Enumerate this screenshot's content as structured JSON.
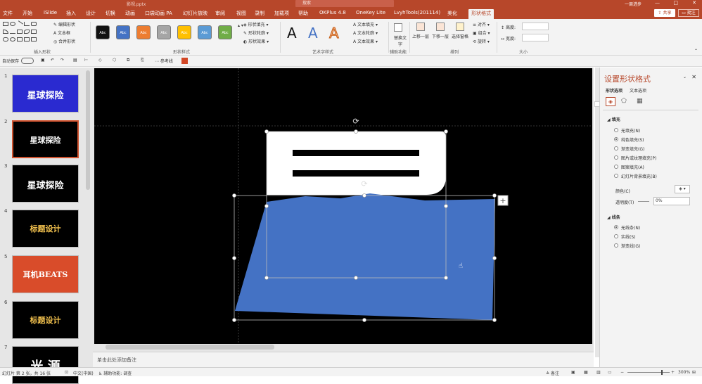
{
  "title_bar": {
    "file": "影视.pptx",
    "search": "搜索",
    "user": "一周进步"
  },
  "tabs": [
    "文件",
    "开始",
    "iSlide",
    "插入",
    "设计",
    "切换",
    "动画",
    "口袋动画 PA",
    "幻灯片放映",
    "审阅",
    "视图",
    "录制",
    "加载项",
    "帮助",
    "OKPlus 4.8",
    "OneKey Lite",
    "LvyhTools(201114)",
    "美化",
    "形状格式"
  ],
  "active_tab": "形状格式",
  "share": "共享",
  "comment": "批注",
  "ribbon": {
    "insert_shapes": {
      "label": "插入形状",
      "edit_shape": "编辑形状",
      "text_box": "文本框",
      "merge_shapes": "合并形状"
    },
    "shape_styles": {
      "label": "形状样式",
      "swatch_text": "Abc",
      "fill": "形状填充",
      "outline": "形状轮廓",
      "effects": "形状效果",
      "swatch_colors": [
        "#111111",
        "#4472c4",
        "#ed7d31",
        "#a5a5a5",
        "#ffc000",
        "#5b9bd5",
        "#70ad47"
      ]
    },
    "wordart": {
      "label": "艺术字样式",
      "letters": [
        "A",
        "A",
        "A"
      ],
      "text_fill": "文本填充",
      "text_outline": "文本轮廓",
      "text_effects": "文本效果"
    },
    "accessibility": {
      "label": "辅助功能",
      "alt_text": "替换文字"
    },
    "arrange": {
      "label": "排列",
      "bring_forward": "上移一层",
      "send_backward": "下移一层",
      "selection_pane": "选择窗格",
      "align": "对齐",
      "group": "组合",
      "rotate": "旋转"
    },
    "size": {
      "label": "大小",
      "height": "高度:",
      "width": "宽度:"
    }
  },
  "qat": {
    "autosave": "自动保存",
    "ref_line": "参考线"
  },
  "slides": [
    {
      "num": "1",
      "text": "星球探险",
      "bg": "#2a2ad0"
    },
    {
      "num": "2",
      "text": "星球探险",
      "bg": "#000000"
    },
    {
      "num": "3",
      "text": "星球探险",
      "bg": "#000000"
    },
    {
      "num": "4",
      "text": "标题设计",
      "bg": "#000000"
    },
    {
      "num": "5",
      "text": "耳机BEATS",
      "bg": "#d94c2a"
    },
    {
      "num": "6",
      "text": "标题设计",
      "bg": "#000000"
    },
    {
      "num": "7",
      "text": "光 源",
      "bg": "#000000"
    }
  ],
  "notes_placeholder": "单击此处添加备注",
  "format_pane": {
    "title": "设置形状格式",
    "tab_shape": "形状选项",
    "tab_text": "文本选项",
    "fill_section": "填充",
    "fill_options": [
      "无填充(N)",
      "纯色填充(S)",
      "渐变填充(G)",
      "图片或纹理填充(P)",
      "图案填充(A)",
      "幻灯片背景填充(B)"
    ],
    "fill_selected": 1,
    "color_label": "颜色(C)",
    "transparency_label": "透明度(T)",
    "transparency_value": "0%",
    "line_section": "线条",
    "line_options": [
      "无线条(N)",
      "实线(S)",
      "渐变线(G)"
    ],
    "line_selected": 0
  },
  "status": {
    "slide_info": "幻灯片 第 2 张，共 16 张",
    "language": "中文(中国)",
    "accessibility": "辅助功能: 调查",
    "notes": "备注",
    "zoom": "300%"
  },
  "colors": {
    "accent": "#b7472a",
    "shape_blue": "#4472c4"
  }
}
